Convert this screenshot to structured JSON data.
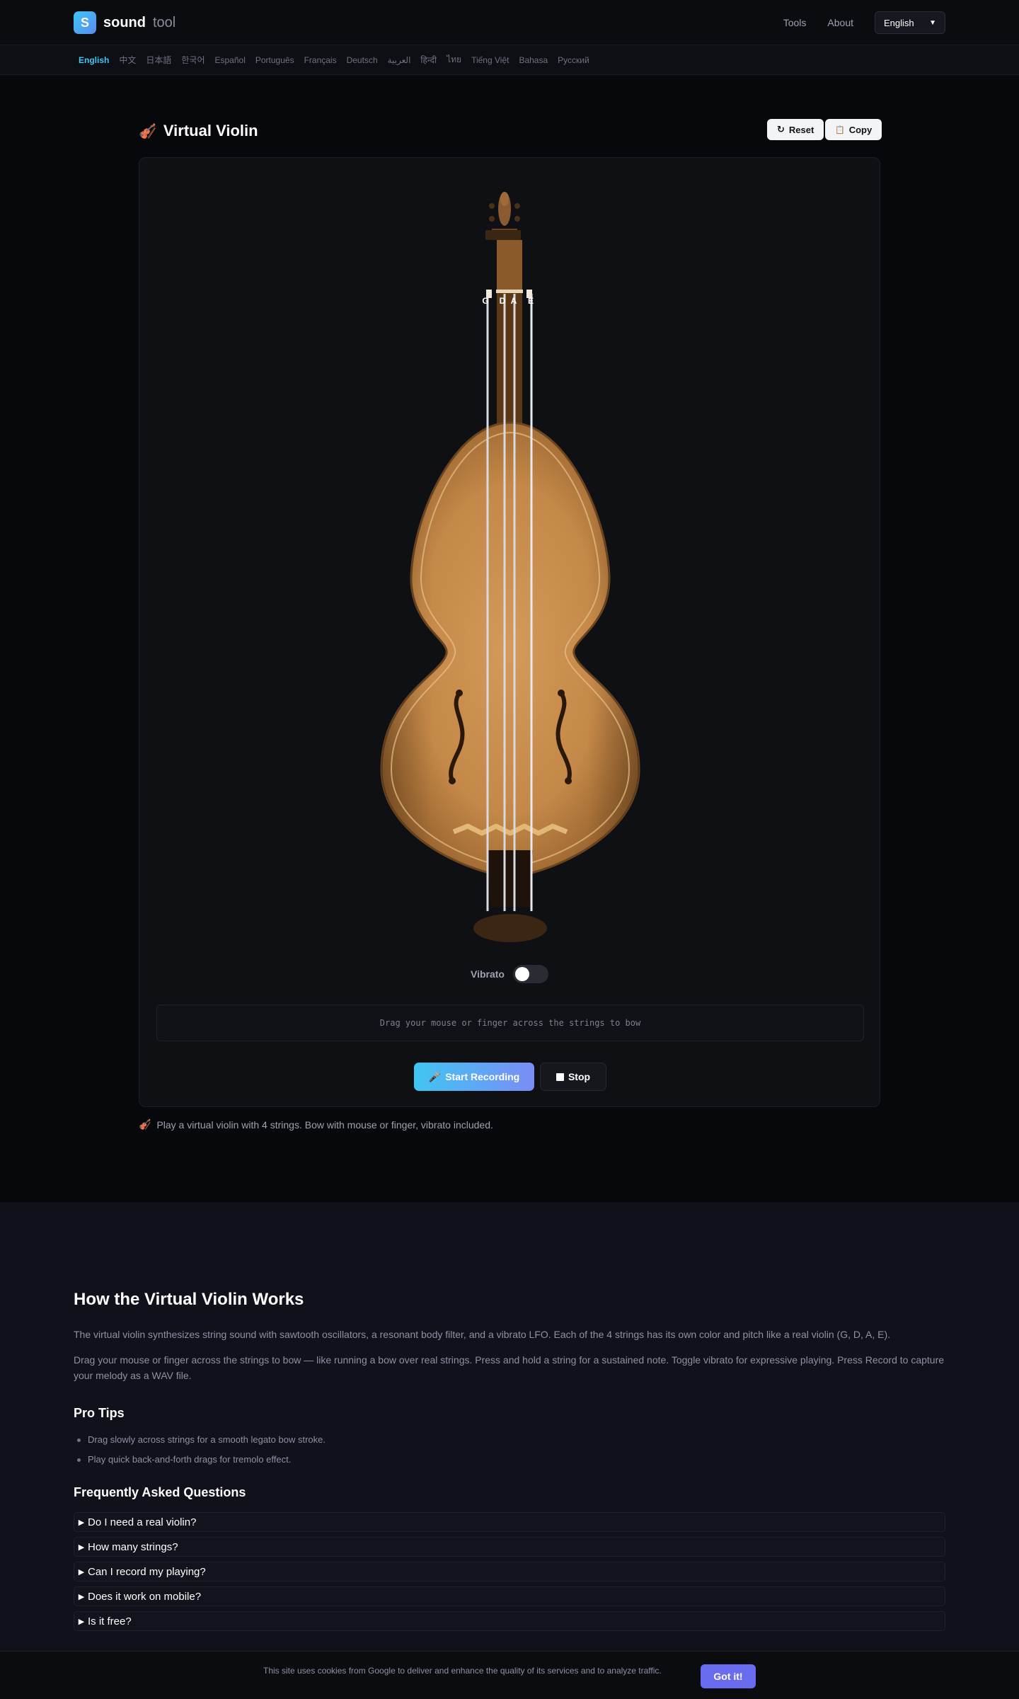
{
  "header": {
    "logo_letter": "S",
    "logo_word": "sound",
    "logo_word2": "tool",
    "nav": [
      "Tools",
      "About"
    ],
    "language": "English"
  },
  "langbar": [
    "English",
    "中文",
    "日本語",
    "한국어",
    "Español",
    "Português",
    "Français",
    "Deutsch",
    "العربية",
    "हिन्दी",
    "ไทย",
    "Tiếng Việt",
    "Bahasa",
    "Русский"
  ],
  "tool": {
    "icon": "🎻",
    "title": "Virtual Violin",
    "reset_label": "Reset",
    "copy_label": "Copy",
    "strings": [
      "G",
      "D",
      "A",
      "E"
    ],
    "vibrato_label": "Vibrato",
    "vibrato_on": false,
    "hint": "Drag your mouse or finger across the strings to bow",
    "record_label": "Start Recording",
    "stop_label": "Stop",
    "tagline": "Play a virtual violin with 4 strings. Bow with mouse or finger, vibrato included."
  },
  "content": {
    "title": "How the Virtual Violin Works",
    "p1": "The virtual violin synthesizes string sound with sawtooth oscillators, a resonant body filter, and a vibrato LFO. Each of the 4 strings has its own color and pitch like a real violin (G, D, A, E).",
    "p2": "Drag your mouse or finger across the strings to bow — like running a bow over real strings. Press and hold a string for a sustained note. Toggle vibrato for expressive playing. Press Record to capture your melody as a WAV file.",
    "tips_title": "Pro Tips",
    "tips": [
      "Drag slowly across strings for a smooth legato bow stroke.",
      "Play quick back-and-forth drags for tremolo effect."
    ],
    "faq_title": "Frequently Asked Questions",
    "faq": [
      "Do I need a real violin?",
      "How many strings?",
      "Can I record my playing?",
      "Does it work on mobile?",
      "Is it free?"
    ]
  },
  "cookie": {
    "text": "This site uses cookies from Google to deliver and enhance the quality of its services and to analyze traffic.",
    "button": "Got it!"
  }
}
